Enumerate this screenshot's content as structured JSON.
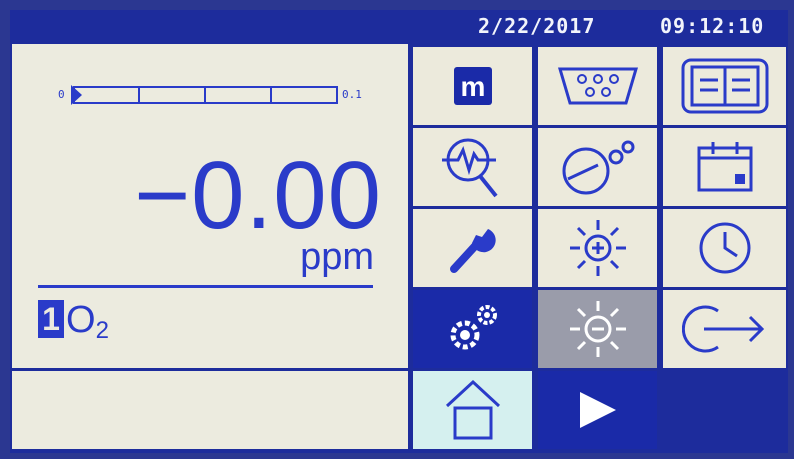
{
  "header": {
    "date": "2/22/2017",
    "time": "09:12:10"
  },
  "measurement": {
    "reading": "−0.00",
    "unit": "ppm",
    "bar_scale_min": "0",
    "bar_scale_max": "0.1",
    "bar_fraction": 0.0
  },
  "channel": {
    "number": "1",
    "gas": "O",
    "gas_subscript": "2"
  },
  "status_text": "",
  "menu": {
    "buttons": [
      {
        "name": "mode-button",
        "icon": "m-icon",
        "label": "m"
      },
      {
        "name": "serial-port-button",
        "icon": "serial-port-icon"
      },
      {
        "name": "manual-button",
        "icon": "book-icon"
      },
      {
        "name": "diagnostics-button",
        "icon": "diagnostic-magnifier-icon"
      },
      {
        "name": "calibration-settings-button",
        "icon": "gauge-gear-icon"
      },
      {
        "name": "calendar-button",
        "icon": "calendar-icon"
      },
      {
        "name": "service-button",
        "icon": "wrench-icon"
      },
      {
        "name": "brightness-up-button",
        "icon": "sun-plus-icon"
      },
      {
        "name": "clock-button",
        "icon": "clock-icon"
      },
      {
        "name": "settings-button",
        "icon": "gears-icon",
        "selected": true
      },
      {
        "name": "brightness-down-button",
        "icon": "sun-minus-icon",
        "disabled": true
      },
      {
        "name": "exit-button",
        "icon": "exit-arrow-icon"
      },
      {
        "name": "home-button",
        "icon": "home-icon"
      },
      {
        "name": "run-button",
        "icon": "play-icon"
      }
    ]
  },
  "colors": {
    "accent": "#2a3bc9",
    "screen": "#1d2c9c",
    "panel": "#ecebdf",
    "highlight": "#d5f0ef"
  }
}
